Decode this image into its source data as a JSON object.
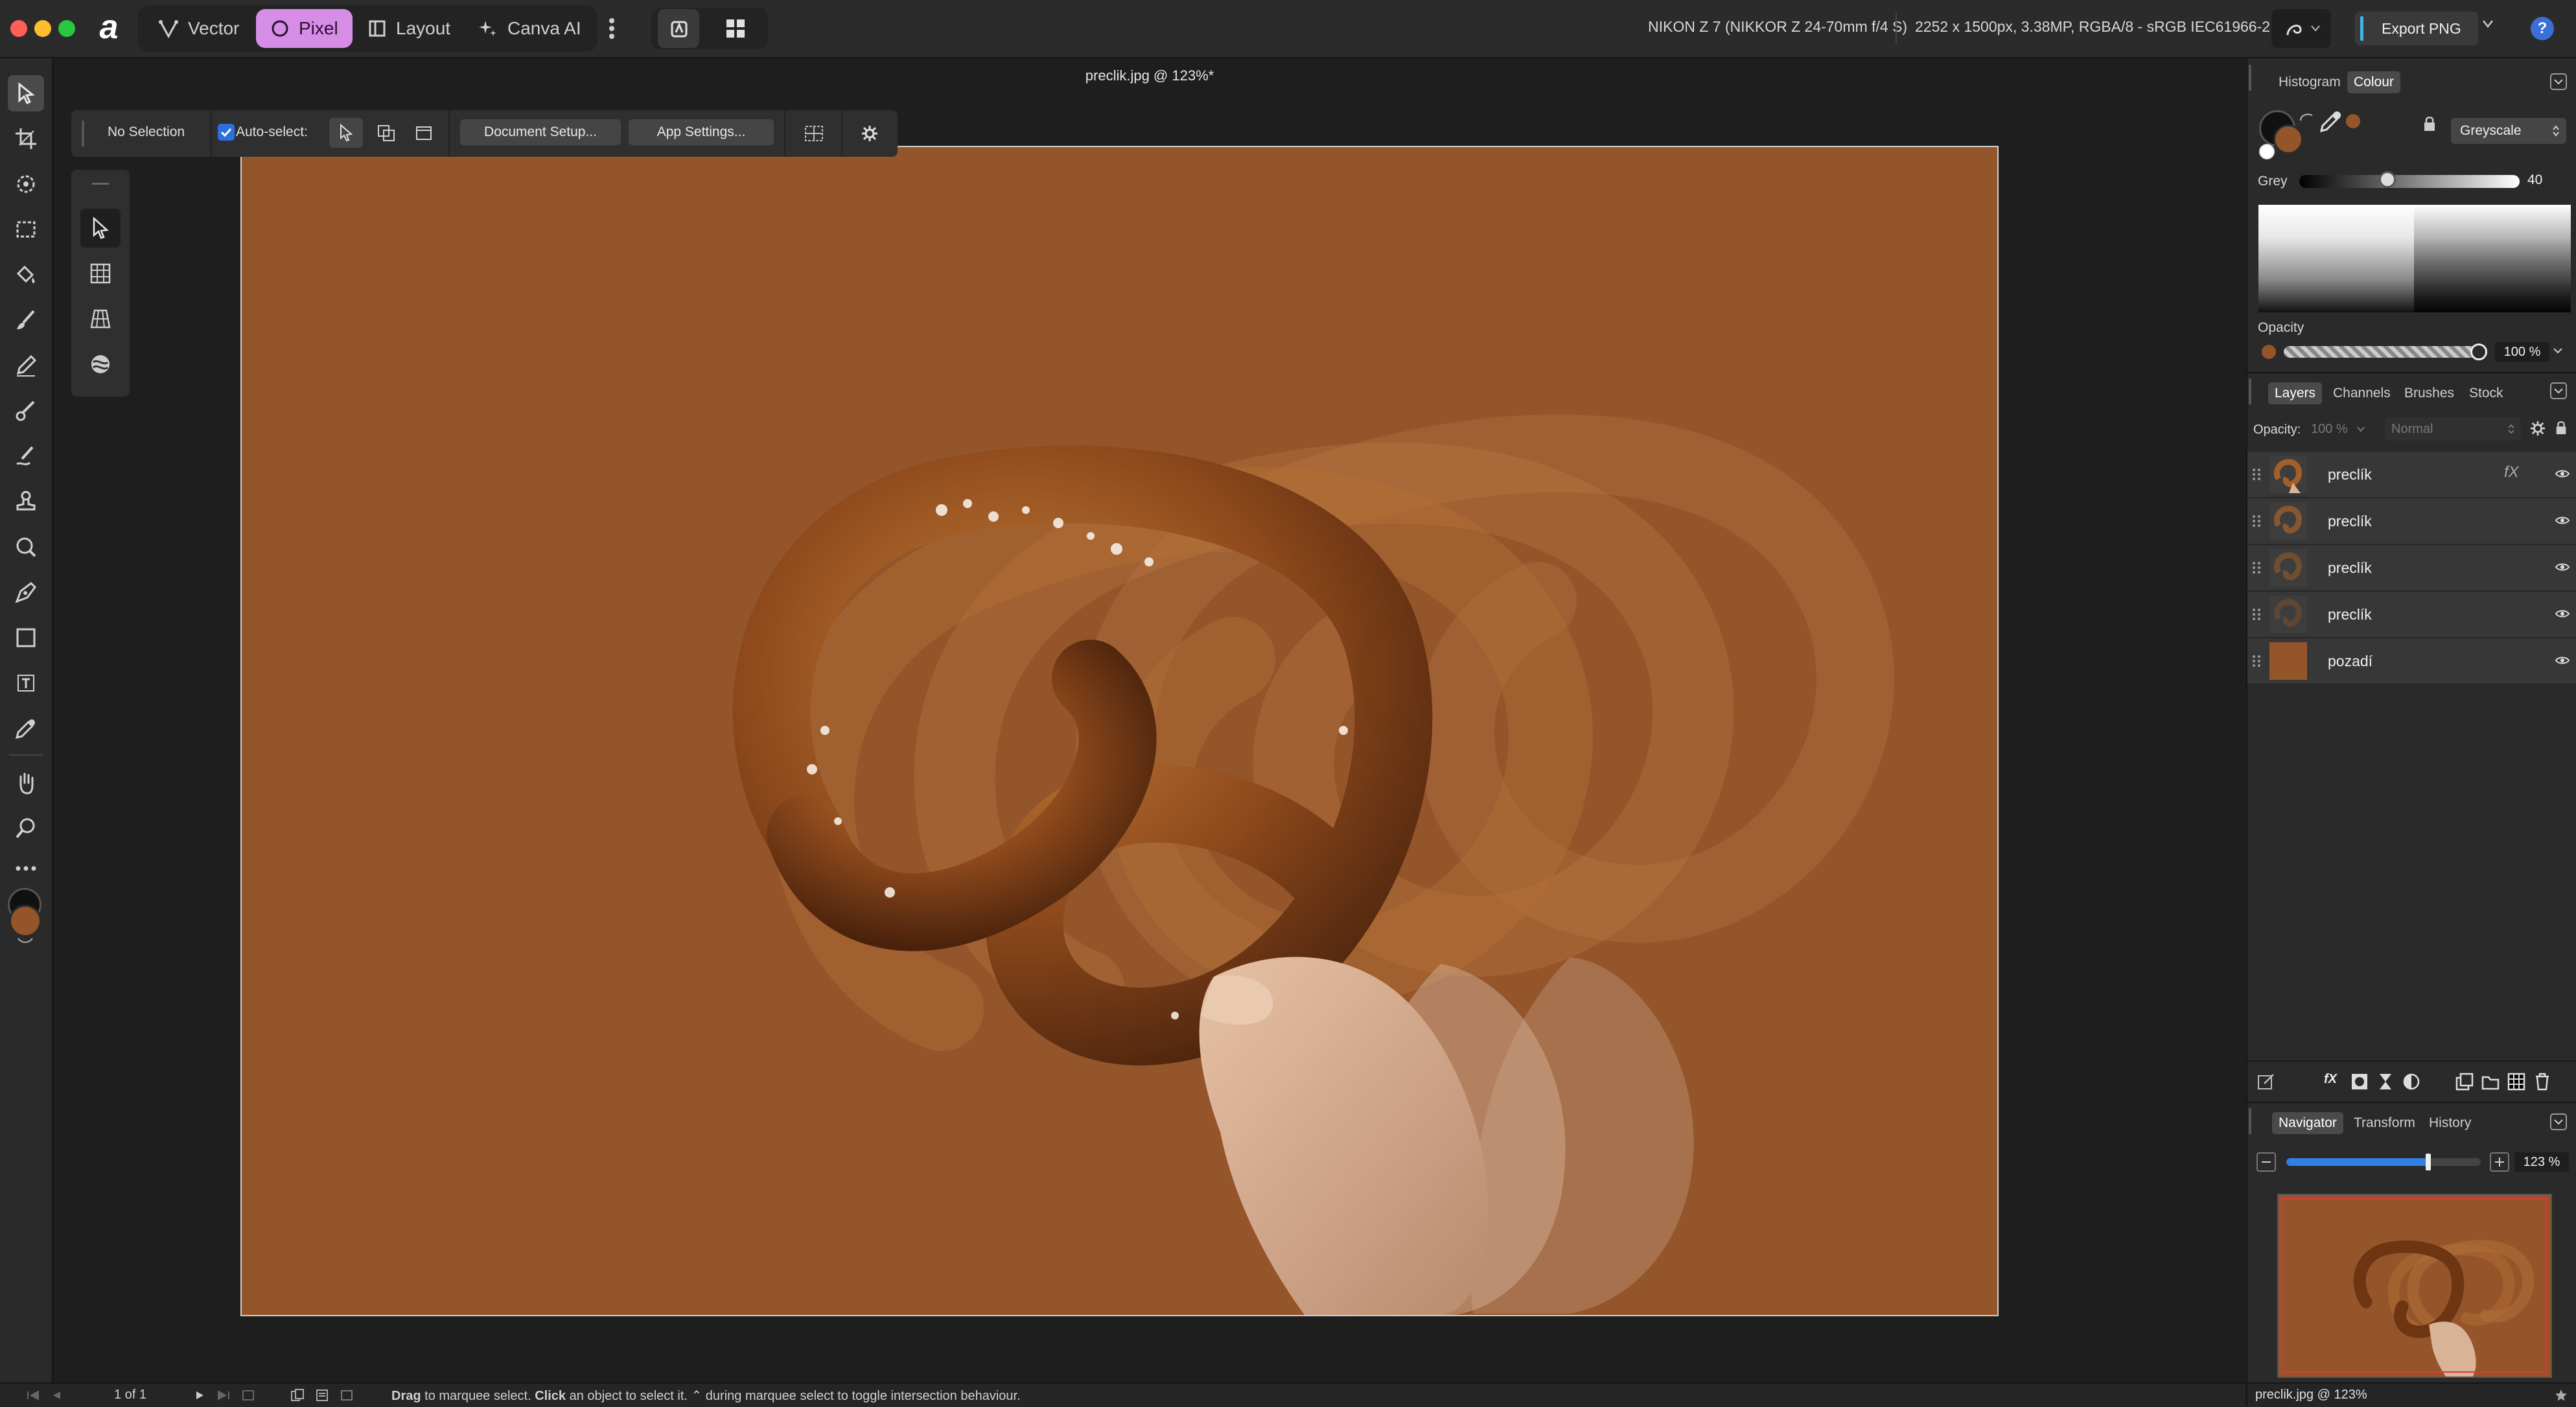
{
  "app": {
    "logo_letter": "a"
  },
  "modes": {
    "vector": "Vector",
    "pixel": "Pixel",
    "layout": "Layout",
    "canva_ai": "Canva AI"
  },
  "meta": {
    "camera": "NIKON Z 7 (NIKKOR Z 24-70mm f/4 S)",
    "image_info": "2252 x 1500px, 3.38MP, RGBA/8 - sRGB IEC61966-2.1"
  },
  "export": {
    "label": "Export PNG"
  },
  "document": {
    "title": "preclik.jpg @ 123%*"
  },
  "context_toolbar": {
    "selection": "No Selection",
    "auto_select": "Auto-select:",
    "document_setup": "Document Setup...",
    "app_settings": "App Settings..."
  },
  "colour_panel": {
    "tabs": [
      "Histogram",
      "Colour"
    ],
    "model": "Greyscale",
    "grey_label": "Grey",
    "grey_value": "40",
    "grey_level": 0.4,
    "opacity_label": "Opacity",
    "opacity_value": "100 %",
    "accent": "#94552a"
  },
  "layers_panel": {
    "tabs": [
      "Layers",
      "Channels",
      "Brushes",
      "Stock"
    ],
    "opacity_label": "Opacity:",
    "opacity_value": "100 %",
    "blend_mode": "Normal",
    "layers": [
      {
        "name": "preclík",
        "fx": "fX"
      },
      {
        "name": "preclík"
      },
      {
        "name": "preclík"
      },
      {
        "name": "preclík"
      },
      {
        "name": "pozadí"
      }
    ]
  },
  "navigator_panel": {
    "tabs": [
      "Navigator",
      "Transform",
      "History"
    ],
    "zoom": "123 %",
    "zoom_level": 0.73
  },
  "status": {
    "page": "1 of 1",
    "hint_drag": "Drag",
    "hint_1": " to marquee select. ",
    "hint_click": "Click",
    "hint_2": " an object to select it. ⌃ during marquee select to toggle intersection behaviour.",
    "doc_label": "preclik.jpg @ 123%"
  },
  "icons": [
    "move-tool-icon",
    "crop-tool-icon",
    "selection-brush-icon",
    "marquee-icon",
    "flood-fill-icon",
    "paint-brush-icon",
    "pencil-icon",
    "retouch-icon",
    "smudge-icon",
    "clone-icon",
    "dodge-icon",
    "pen-icon",
    "rectangle-icon",
    "text-icon",
    "color-picker-icon",
    "hand-icon",
    "zoom-icon",
    "more-icon"
  ],
  "colors": {
    "canvas_bg": "#94552a",
    "pixel_mode": "#d68de6",
    "export_accent": "#3fb7e0",
    "primary_colour": "#111111",
    "secondary_colour": "#94552a"
  }
}
